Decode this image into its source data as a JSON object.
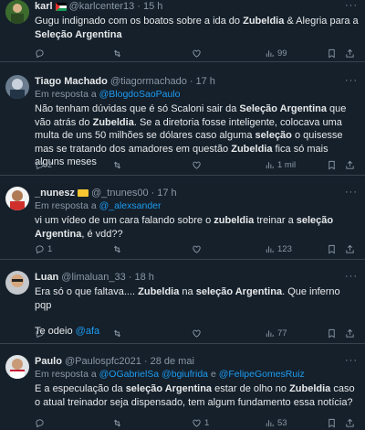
{
  "tweets": [
    {
      "name": "karl",
      "handle": "@karlcenter13",
      "time": "15 h",
      "reply_prefix": "",
      "reply_handles": [],
      "text_segments": [
        {
          "t": "Gugu indignado com os boatos sobre a ida do ",
          "b": false
        },
        {
          "t": "Zubeldia",
          "b": true
        },
        {
          "t": " & Alegria para a ",
          "b": false
        },
        {
          "t": "Seleção Argentina",
          "b": true
        }
      ],
      "stats": {
        "replies": "",
        "retweets": "",
        "likes": "",
        "views": "99"
      }
    },
    {
      "name": "Tiago Machado",
      "handle": "@tiagormachado",
      "time": "17 h",
      "reply_prefix": "Em resposta a",
      "reply_handles": [
        "@BlogdoSaoPaulo"
      ],
      "text_segments": [
        {
          "t": "Não tenham dúvidas que é só Scaloni sair da ",
          "b": false
        },
        {
          "t": "Seleção Argentina",
          "b": true
        },
        {
          "t": " que vão atrás do ",
          "b": false
        },
        {
          "t": "Zubeldia",
          "b": true
        },
        {
          "t": ". Se a diretoria fosse inteligente, colocava uma multa de uns 50 milhões se dólares caso alguma ",
          "b": false
        },
        {
          "t": "seleção",
          "b": true
        },
        {
          "t": " o quisesse mas se tratando dos amadores em questão ",
          "b": false
        },
        {
          "t": "Zubeldia",
          "b": true
        },
        {
          "t": " fica só mais alguns meses",
          "b": false
        }
      ],
      "stats": {
        "replies": "2",
        "retweets": "",
        "likes": "",
        "views": "1 mil"
      }
    },
    {
      "name": "_nunesz",
      "handle": "@_tnunes00",
      "time": "17 h",
      "reply_prefix": "Em resposta a",
      "reply_handles": [
        "@_alexsander"
      ],
      "text_segments": [
        {
          "t": "vi um vídeo de um cara falando sobre o ",
          "b": false
        },
        {
          "t": "zubeldia",
          "b": true
        },
        {
          "t": " treinar a ",
          "b": false
        },
        {
          "t": "seleção Argentina",
          "b": true
        },
        {
          "t": ", é vdd??",
          "b": false
        }
      ],
      "stats": {
        "replies": "1",
        "retweets": "",
        "likes": "",
        "views": "123"
      }
    },
    {
      "name": "Luan",
      "handle": "@limaluan_33",
      "time": "18 h",
      "reply_prefix": "",
      "reply_handles": [],
      "text_segments": [
        {
          "t": "Era só o que faltava.... ",
          "b": false
        },
        {
          "t": "Zubeldia",
          "b": true
        },
        {
          "t": " na ",
          "b": false
        },
        {
          "t": "seleção Argentina",
          "b": true
        },
        {
          "t": ". Que inferno pqp",
          "b": false
        }
      ],
      "text2_prefix": "Te odeio ",
      "text2_link": "@afa",
      "stats": {
        "replies": "",
        "retweets": "",
        "likes": "",
        "views": "77"
      }
    },
    {
      "name": "Paulo",
      "handle": "@Paulospfc2021",
      "time": "28 de mai",
      "reply_prefix": "Em resposta a",
      "reply_handles": [
        "@OGabrielSa",
        "@bgiufrida",
        "@FelipeGomesRuiz"
      ],
      "text_segments": [
        {
          "t": "E a especulação da ",
          "b": false
        },
        {
          "t": "seleção Argentina",
          "b": true
        },
        {
          "t": " estar de olho no ",
          "b": false
        },
        {
          "t": "Zubeldia",
          "b": true
        },
        {
          "t": " caso o atual treinador seja dispensado, tem algum fundamento essa notícia?",
          "b": false
        }
      ],
      "stats": {
        "replies": "",
        "retweets": "",
        "likes": "1",
        "views": "53"
      }
    }
  ],
  "separator_dot": "·",
  "more_glyph": "···",
  "conjunction": "e",
  "colors": {
    "background": "#15202b",
    "text": "#e7e9ea",
    "muted": "#8b98a5",
    "link": "#1d9bf0",
    "border": "#38444d"
  },
  "icons": [
    "reply-icon",
    "retweet-icon",
    "like-icon",
    "views-icon",
    "bookmark-icon",
    "share-icon",
    "more-icon"
  ]
}
